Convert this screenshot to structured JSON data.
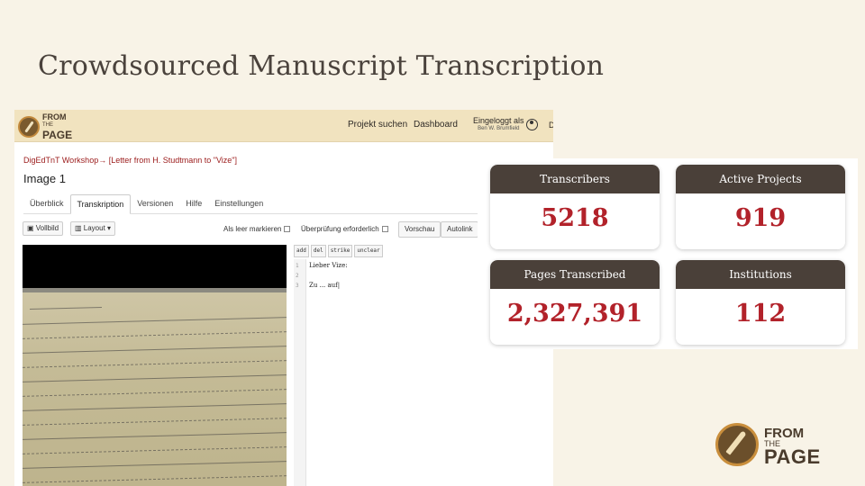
{
  "slide": {
    "title": "Crowdsourced Manuscript Transcription"
  },
  "app": {
    "logo": {
      "from": "FROM",
      "the": "THE",
      "page": "PAGE"
    },
    "nav": {
      "search": "Projekt suchen",
      "dashboard": "Dashboard"
    },
    "login": {
      "label": "Eingeloggt als",
      "user": "Ben W. Brumfield"
    },
    "lang": "DE"
  },
  "breadcrumb": {
    "collection": "DigEdTnT Workshop",
    "sep": "→",
    "work": "[Letter from H. Studtmann to \"Vize\"]"
  },
  "page_title": "Image 1",
  "tabs": [
    {
      "label": "Überblick"
    },
    {
      "label": "Transkription"
    },
    {
      "label": "Versionen"
    },
    {
      "label": "Hilfe"
    },
    {
      "label": "Einstellungen"
    }
  ],
  "toolbar": {
    "fullscreen": "Vollbild",
    "layout": "Layout",
    "mark_blank": "Als leer markieren",
    "needs_review": "Überprüfung erforderlich",
    "preview": "Vorschau",
    "autolink": "Autolink"
  },
  "editor": {
    "tags": [
      "add",
      "del",
      "strike",
      "unclear"
    ],
    "lines": [
      {
        "num": "1",
        "text": "Lieber Vize:"
      },
      {
        "num": "2",
        "text": ""
      },
      {
        "num": "3",
        "text": "Zu ... auf|"
      }
    ]
  },
  "stats": [
    {
      "label": "Transcribers",
      "value": "5218"
    },
    {
      "label": "Active Projects",
      "value": "919"
    },
    {
      "label": "Pages Transcribed",
      "value": "2,327,391"
    },
    {
      "label": "Institutions",
      "value": "112"
    }
  ],
  "colors": {
    "header_bg": "#f1e3bf",
    "card_head": "#4a4039",
    "stat_value": "#b2222a",
    "link": "#9b1b1b"
  }
}
